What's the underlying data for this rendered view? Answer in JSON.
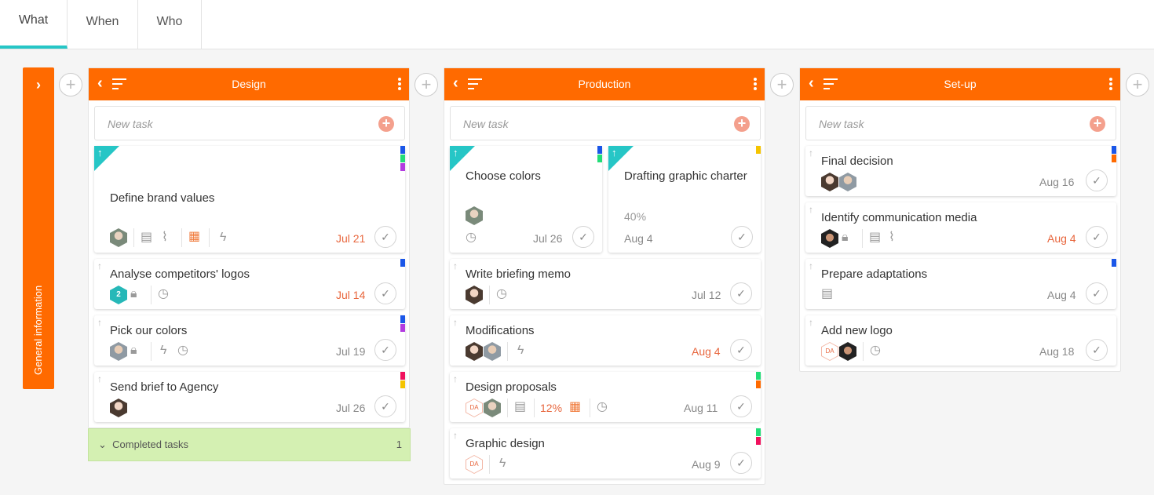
{
  "tabs": [
    {
      "label": "What",
      "active": true
    },
    {
      "label": "When",
      "active": false
    },
    {
      "label": "Who",
      "active": false
    }
  ],
  "collapsed_column": {
    "label": "General information"
  },
  "new_task_placeholder": "New task",
  "accent_color": "#ff6a00",
  "completed": {
    "label": "Completed tasks",
    "count": "1"
  },
  "columns": [
    {
      "title": "Design",
      "cards": [
        {
          "title": "Define brand values",
          "date": "Jul 21"
        },
        {
          "title": "Analyse competitors' logos",
          "date": "Jul 14",
          "avatar_count": "2"
        },
        {
          "title": "Pick our colors",
          "date": "Jul 19"
        },
        {
          "title": "Send brief to Agency",
          "date": "Jul 26"
        }
      ]
    },
    {
      "title": "Production",
      "cards": [
        {
          "title": "Choose colors",
          "date": "Jul 26"
        },
        {
          "title": "Drafting graphic charter",
          "date": "Aug 4",
          "progress": "40%"
        },
        {
          "title": "Write briefing memo",
          "date": "Jul 12"
        },
        {
          "title": "Modifications",
          "date": "Aug 4"
        },
        {
          "title": "Design proposals",
          "date": "Aug 11",
          "progress": "12%"
        },
        {
          "title": "Graphic design",
          "date": "Aug 9"
        }
      ]
    },
    {
      "title": "Set-up",
      "cards": [
        {
          "title": "Final decision",
          "date": "Aug 16"
        },
        {
          "title": "Identify communication media",
          "date": "Aug 4"
        },
        {
          "title": "Prepare adaptations",
          "date": "Aug 4"
        },
        {
          "title": "Add new logo",
          "date": "Aug 18"
        }
      ]
    }
  ],
  "initials": "DA"
}
